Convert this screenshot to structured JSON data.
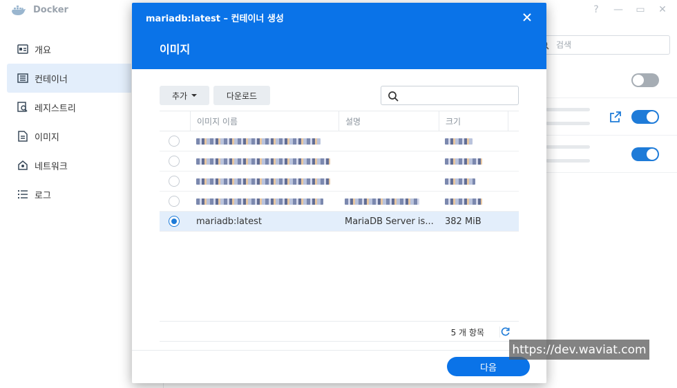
{
  "app": {
    "title": "Docker",
    "window_buttons": [
      "?",
      "—",
      "▭",
      "✕"
    ],
    "search_placeholder": "검색"
  },
  "sidebar": {
    "items": [
      {
        "label": "개요",
        "icon": "overview-icon",
        "active": false
      },
      {
        "label": "컨테이너",
        "icon": "container-icon",
        "active": true
      },
      {
        "label": "레지스트리",
        "icon": "registry-icon",
        "active": false
      },
      {
        "label": "이미지",
        "icon": "image-icon",
        "active": false
      },
      {
        "label": "네트워크",
        "icon": "network-icon",
        "active": false
      },
      {
        "label": "로그",
        "icon": "log-icon",
        "active": false
      }
    ]
  },
  "background_toggles": [
    {
      "state": "off"
    },
    {
      "state": "on"
    },
    {
      "state": "on"
    }
  ],
  "dialog": {
    "title": "mariadb:latest – 컨테이너 생성",
    "step_title": "이미지",
    "toolbar": {
      "add_label": "추가",
      "download_label": "다운로드",
      "search_placeholder": ""
    },
    "table": {
      "columns": [
        "",
        "이미지 이름",
        "설명",
        "크기"
      ],
      "rows": [
        {
          "name": "",
          "description": "",
          "size": "",
          "blurred": true,
          "selected": false
        },
        {
          "name": "",
          "description": "",
          "size": "",
          "blurred": true,
          "selected": false
        },
        {
          "name": "",
          "description": "",
          "size": "",
          "blurred": true,
          "selected": false
        },
        {
          "name": "",
          "description": "",
          "size": "",
          "blurred": true,
          "selected": false
        },
        {
          "name": "mariadb:latest",
          "description": "MariaDB Server is...",
          "size": "382 MiB",
          "blurred": false,
          "selected": true
        }
      ]
    },
    "item_count": "5 개 항목",
    "next_label": "다음"
  },
  "watermark": "https://dev.waviat.com",
  "colors": {
    "accent": "#0a73e8",
    "selected_row": "#e3eefb",
    "toggle_on": "#1e7bd8",
    "toggle_off": "#a6adb4"
  }
}
